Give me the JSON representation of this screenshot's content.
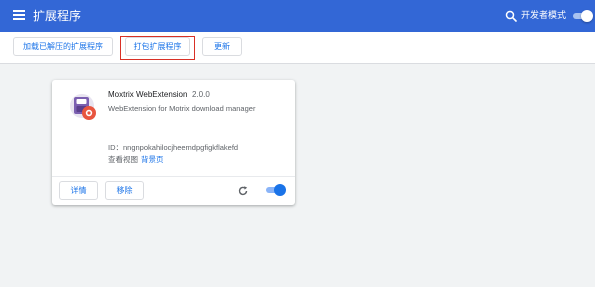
{
  "header": {
    "title": "扩展程序",
    "search_icon": "search-icon",
    "dev_mode_label": "开发者模式",
    "dev_mode_on": true,
    "menu_icon": "hamburger-menu-icon"
  },
  "toolbar": {
    "load_unpacked": "加载已解压的扩展程序",
    "pack": "打包扩展程序",
    "update": "更新"
  },
  "extension": {
    "name": "Moxtrix WebExtension",
    "version": "2.0.0",
    "description": "WebExtension for Motrix download manager",
    "id_label": "ID：",
    "id_value": "nngnpokahilocjheemdpgfigkflakefd",
    "id_text": "ID：nngnpokahilocjheemdpgfigkflakefd",
    "views_label": "查看视图",
    "views_link": "背景页",
    "details_button": "详情",
    "remove_button": "移除",
    "enabled": true,
    "reload_icon": "reload-icon"
  },
  "colors": {
    "header_bg": "#3367d6",
    "accent": "#1a73e8",
    "highlight_border": "#d93025",
    "page_bg": "#f1f3f4"
  }
}
